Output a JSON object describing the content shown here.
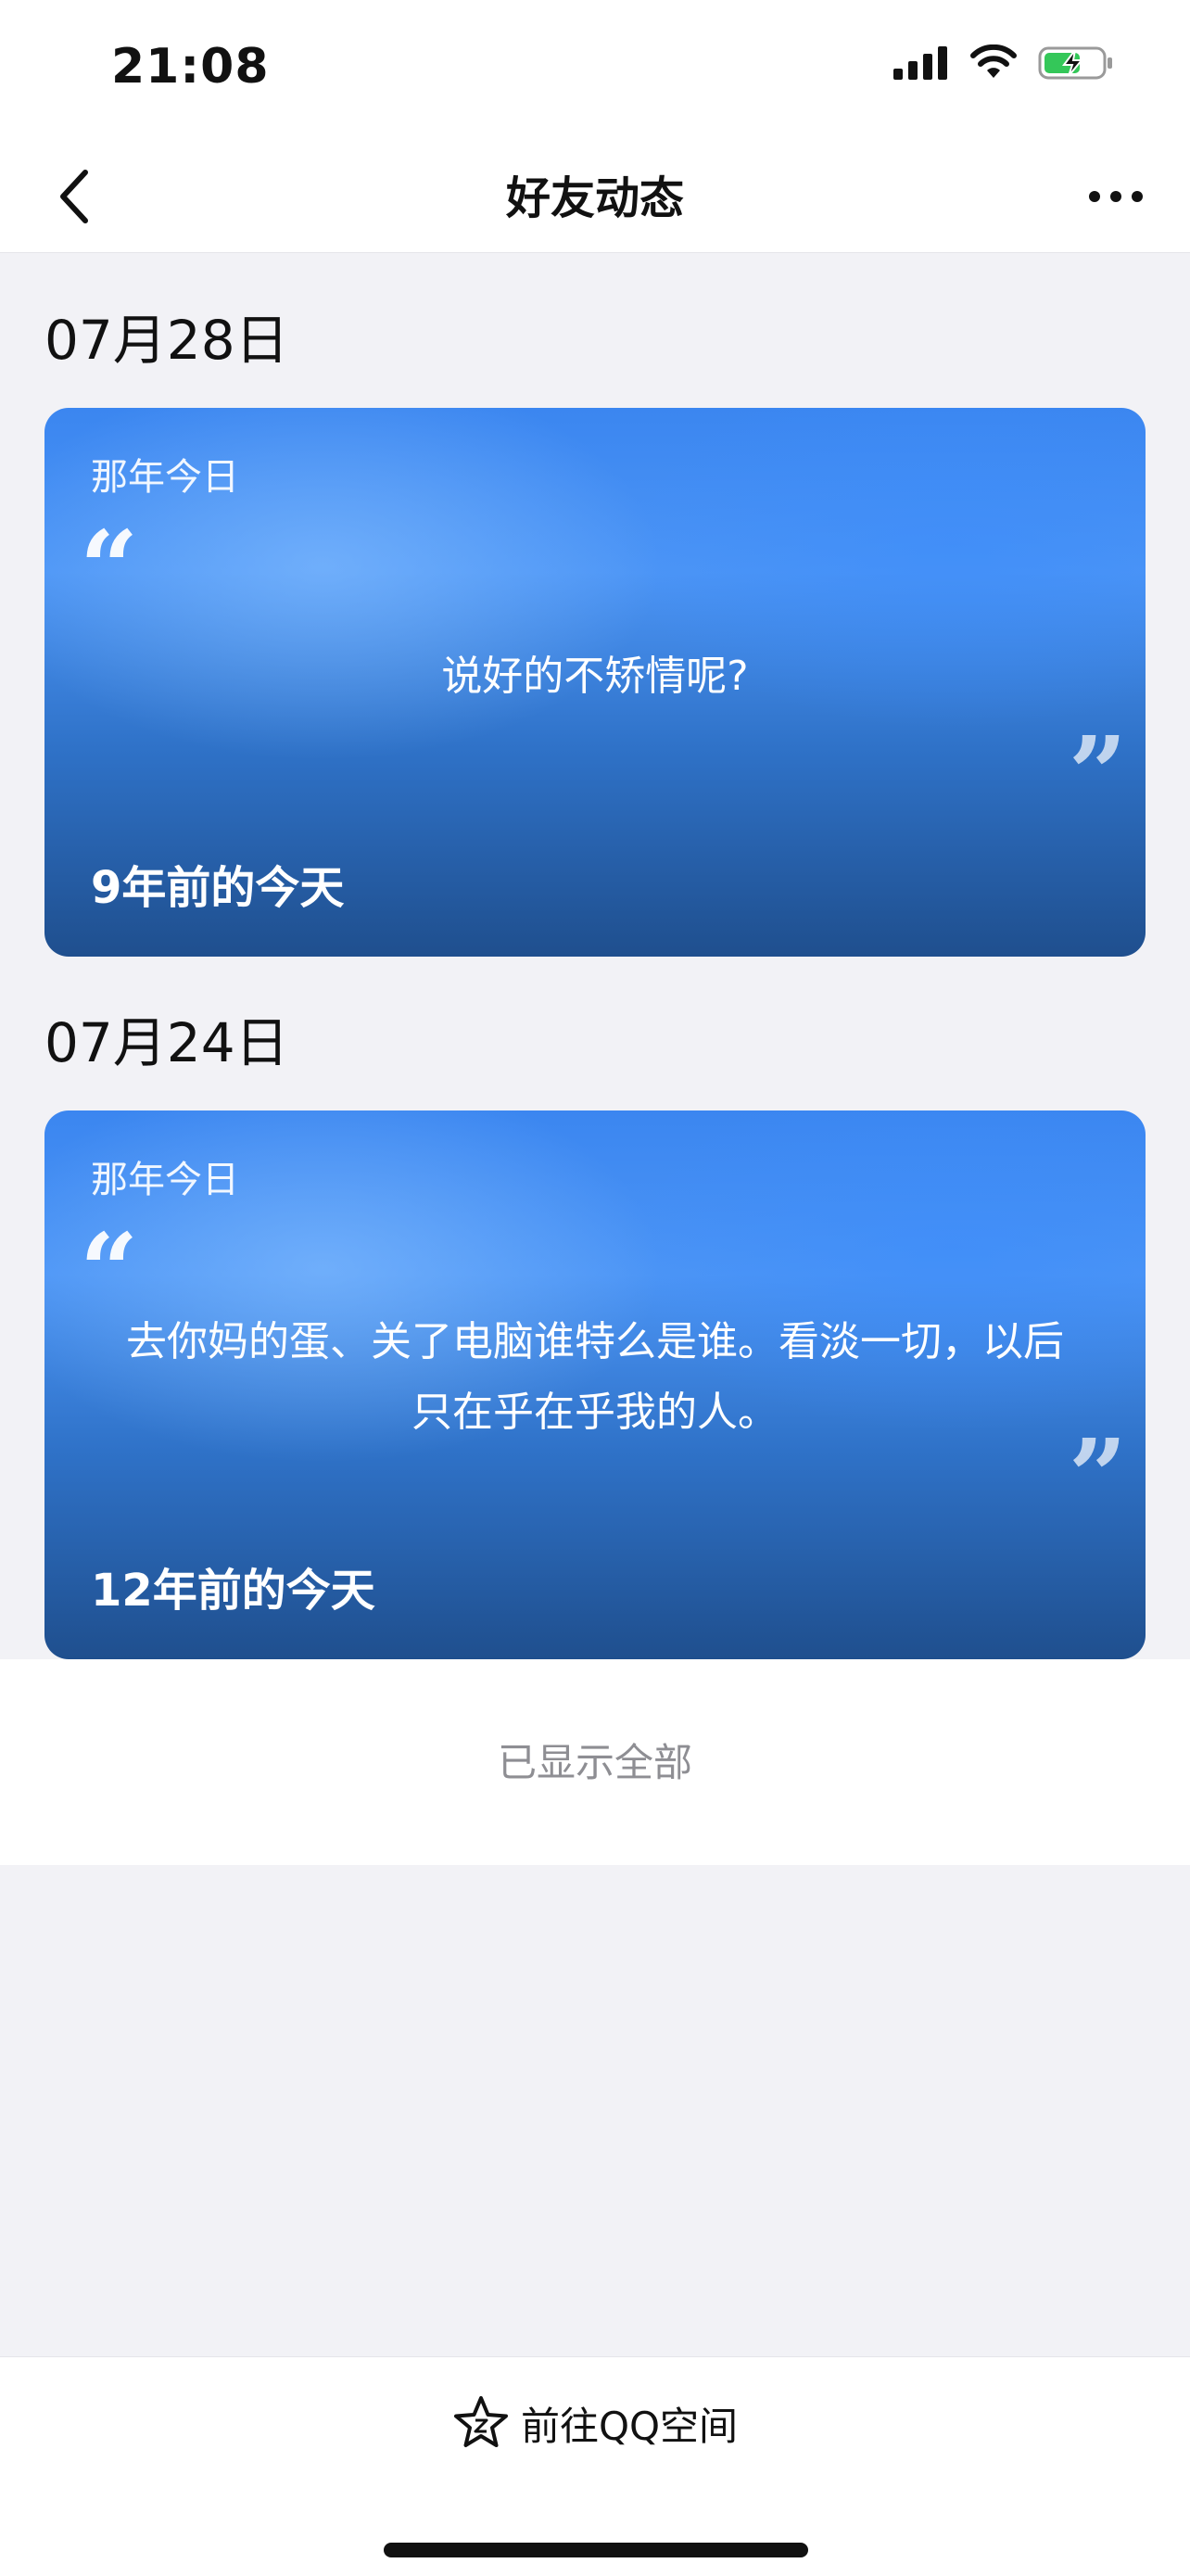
{
  "status_bar": {
    "time": "21:08",
    "icons": [
      "signal-icon",
      "wifi-icon",
      "battery-charging-icon"
    ]
  },
  "nav": {
    "title": "好友动态",
    "back_icon": "chevron-left-icon",
    "more_icon": "more-dots-icon"
  },
  "sections": [
    {
      "date": "07月28日",
      "card": {
        "label": "那年今日",
        "text": "说好的不矫情呢?",
        "years_ago": "9年前的今天"
      }
    },
    {
      "date": "07月24日",
      "card": {
        "label": "那年今日",
        "text": "去你妈的蛋、关了电脑谁特么是谁。看淡一切，以后只在乎在乎我的人。",
        "years_ago": "12年前的今天"
      }
    }
  ],
  "end_notice": "已显示全部",
  "bottom": {
    "qzone_label": "前往QQ空间",
    "qzone_icon": "star-icon"
  },
  "colors": {
    "card_blue": "#3b86f0",
    "background": "#f2f2f6"
  }
}
